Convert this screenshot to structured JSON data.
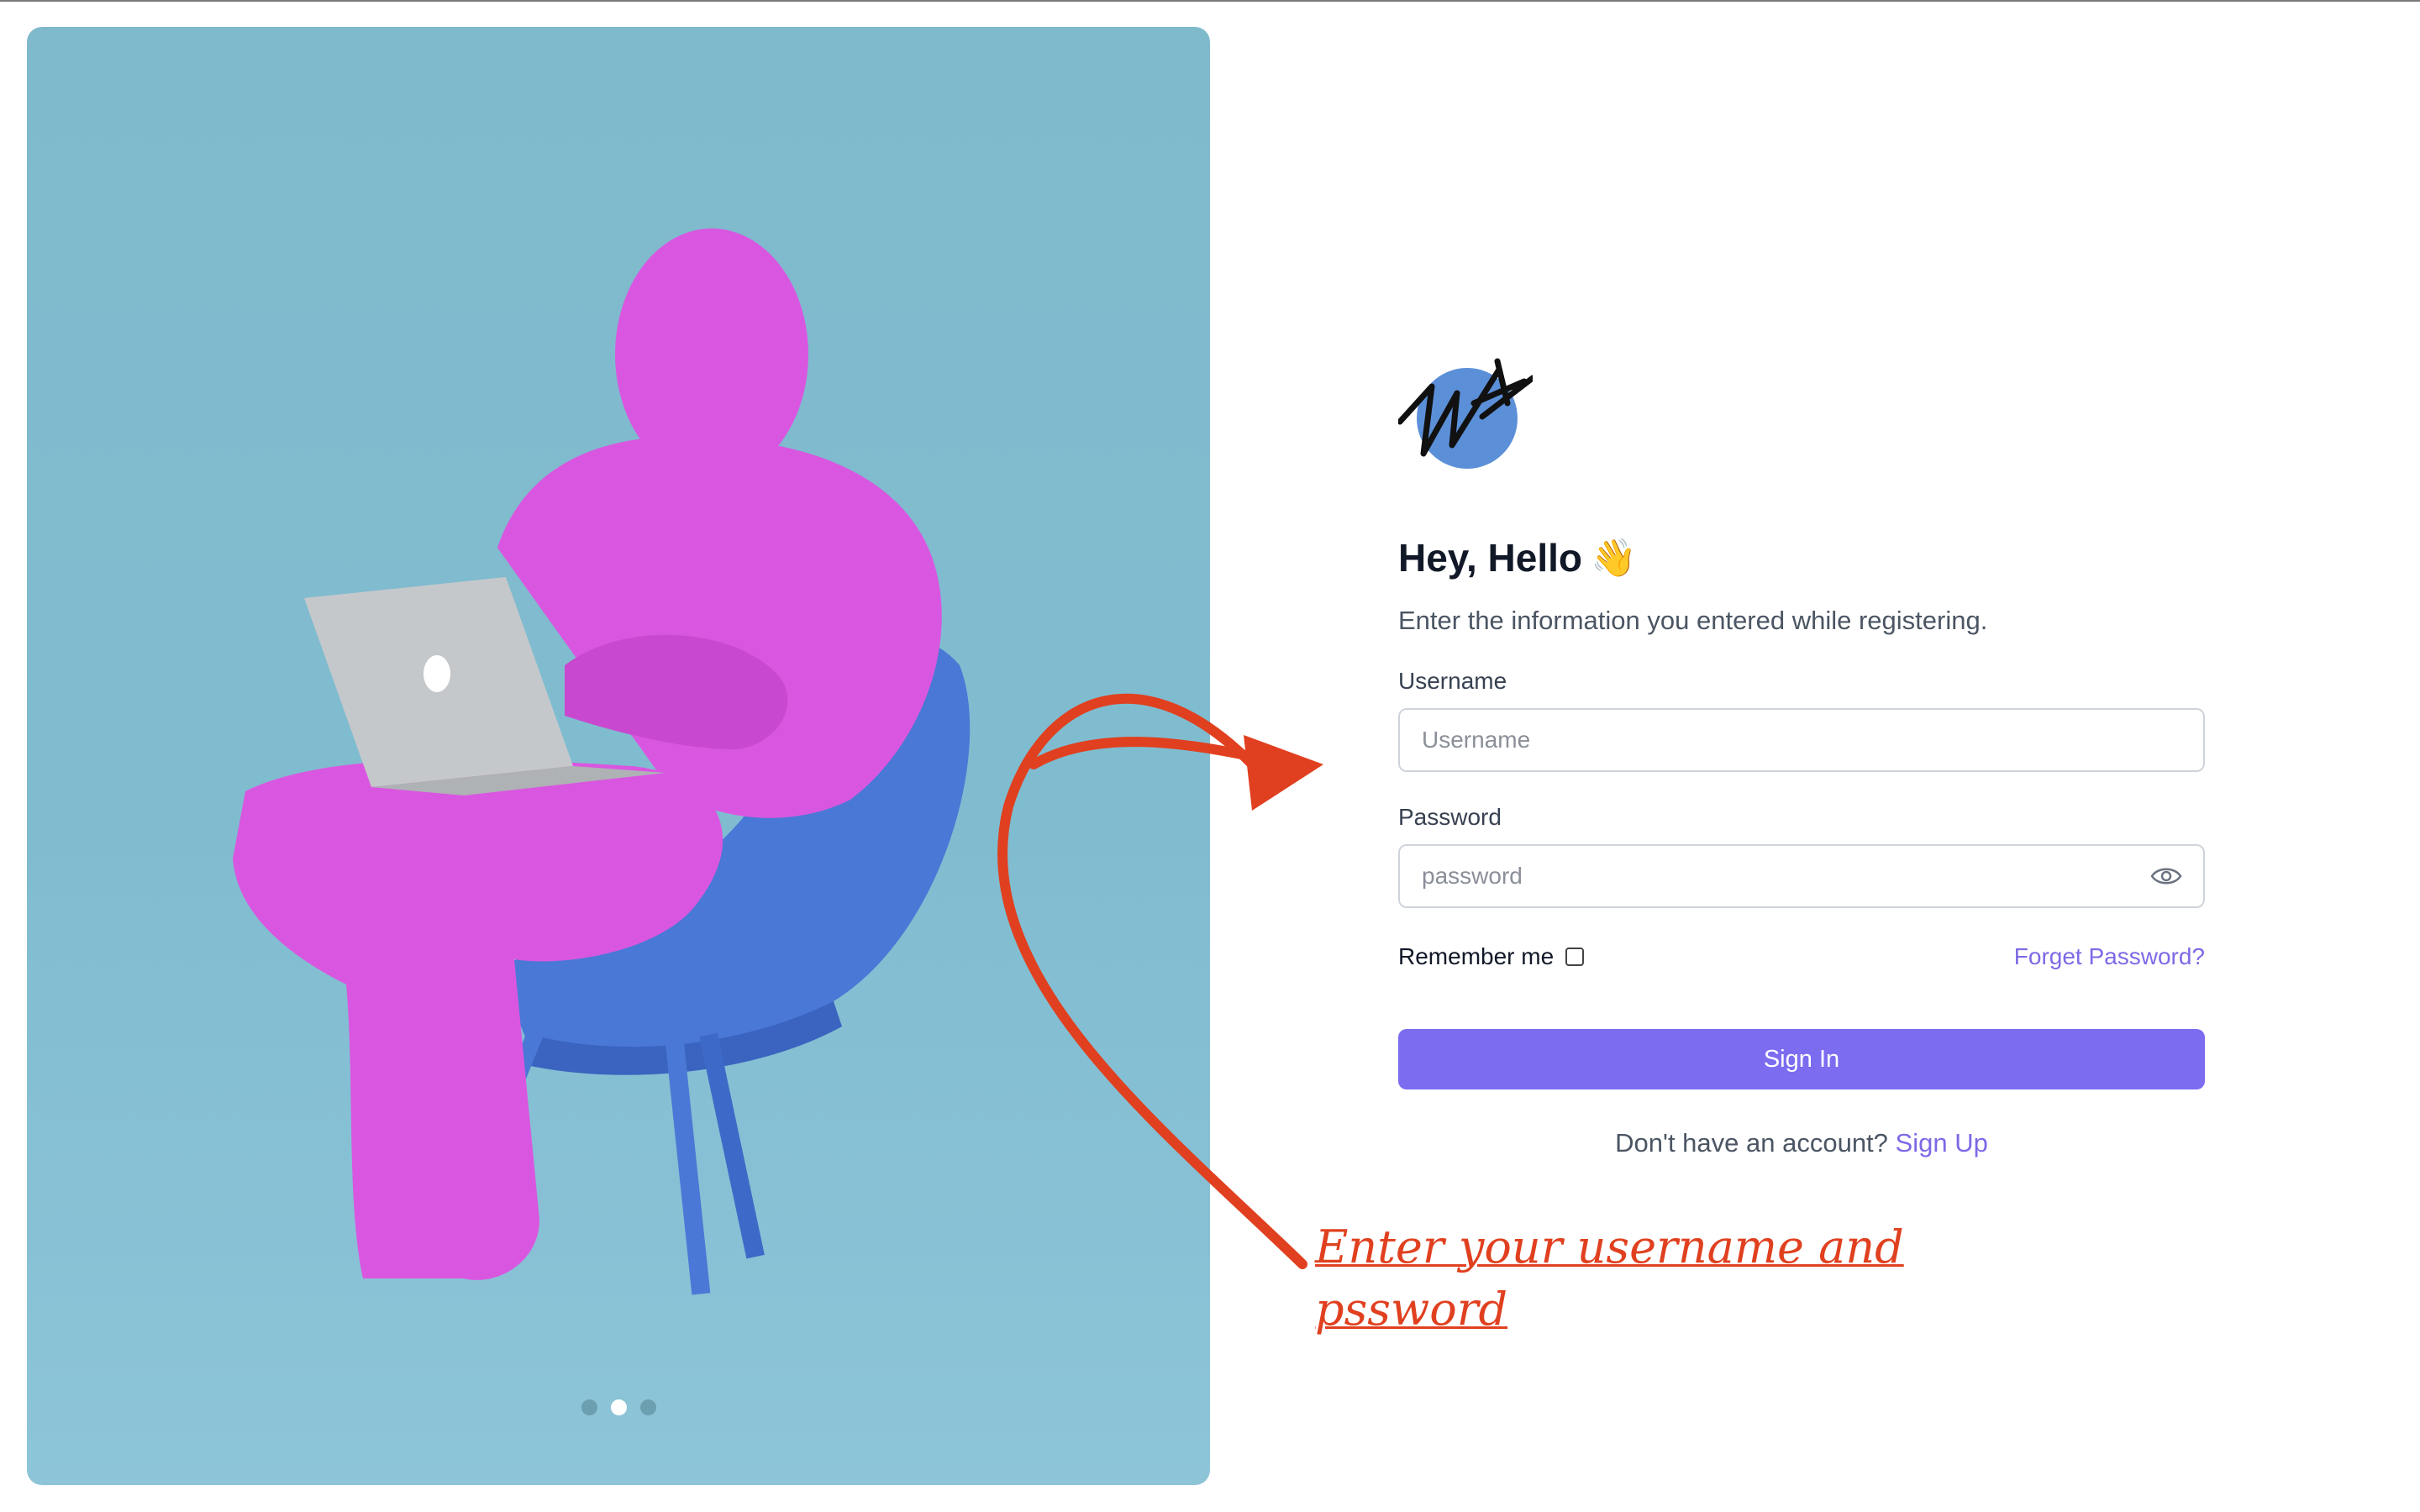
{
  "hero": {
    "illustration": "pink-furry-character-on-blue-chair-with-laptop",
    "carousel_dots": 3,
    "active_dot": 1,
    "background_color": "#80bcd0"
  },
  "logo": {
    "icon": "scribble-logo-icon",
    "circle_color": "#5b8fd8"
  },
  "form": {
    "title": "Hey, Hello",
    "title_emoji": "👋",
    "subtitle": "Enter the information you entered while registering.",
    "username_label": "Username",
    "username_placeholder": "Username",
    "password_label": "Password",
    "password_placeholder": "password",
    "remember_label": "Remember me",
    "remember_checked": false,
    "forgot_label": "Forget Password?",
    "signin_label": "Sign In",
    "signup_prompt": "Don't have an account?",
    "signup_link": "Sign Up",
    "accent_color": "#7c6cf0"
  },
  "annotation": {
    "text": "Enter your username and pssword",
    "color": "#e0401f"
  }
}
